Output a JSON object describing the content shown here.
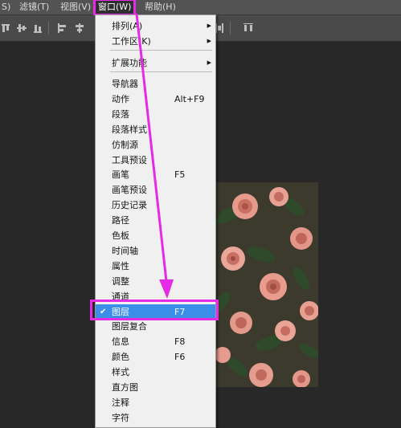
{
  "menubar": {
    "items": [
      {
        "label": "S)"
      },
      {
        "label": "滤镜(T)"
      },
      {
        "label": "视图(V)"
      },
      {
        "label": "窗口(W)"
      },
      {
        "label": "帮助(H)"
      }
    ]
  },
  "window_menu": {
    "top_items": [
      {
        "label": "排列(A)",
        "submenu": true
      },
      {
        "label": "工作区(K)",
        "submenu": true
      },
      {
        "label": "扩展功能",
        "submenu": true
      }
    ],
    "items": [
      {
        "label": "导航器",
        "shortcut": ""
      },
      {
        "label": "动作",
        "shortcut": "Alt+F9"
      },
      {
        "label": "段落",
        "shortcut": ""
      },
      {
        "label": "段落样式",
        "shortcut": ""
      },
      {
        "label": "仿制源",
        "shortcut": ""
      },
      {
        "label": "工具预设",
        "shortcut": ""
      },
      {
        "label": "画笔",
        "shortcut": "F5"
      },
      {
        "label": "画笔预设",
        "shortcut": ""
      },
      {
        "label": "历史记录",
        "shortcut": ""
      },
      {
        "label": "路径",
        "shortcut": ""
      },
      {
        "label": "色板",
        "shortcut": ""
      },
      {
        "label": "时间轴",
        "shortcut": ""
      },
      {
        "label": "属性",
        "shortcut": ""
      },
      {
        "label": "调整",
        "shortcut": ""
      },
      {
        "label": "通道",
        "shortcut": ""
      },
      {
        "label": "图层",
        "shortcut": "F7",
        "checked": true,
        "highlighted": true
      },
      {
        "label": "图层复合",
        "shortcut": ""
      },
      {
        "label": "信息",
        "shortcut": "F8"
      },
      {
        "label": "颜色",
        "shortcut": "F6"
      },
      {
        "label": "样式",
        "shortcut": ""
      },
      {
        "label": "直方图",
        "shortcut": ""
      },
      {
        "label": "注释",
        "shortcut": ""
      },
      {
        "label": "字符",
        "shortcut": ""
      }
    ],
    "checkmark": "✔",
    "submenu_arrow": "▶"
  },
  "colors": {
    "annotation": "#e62ae6",
    "highlight": "#3c8fe8",
    "menu_bg": "#f0f0f0"
  }
}
